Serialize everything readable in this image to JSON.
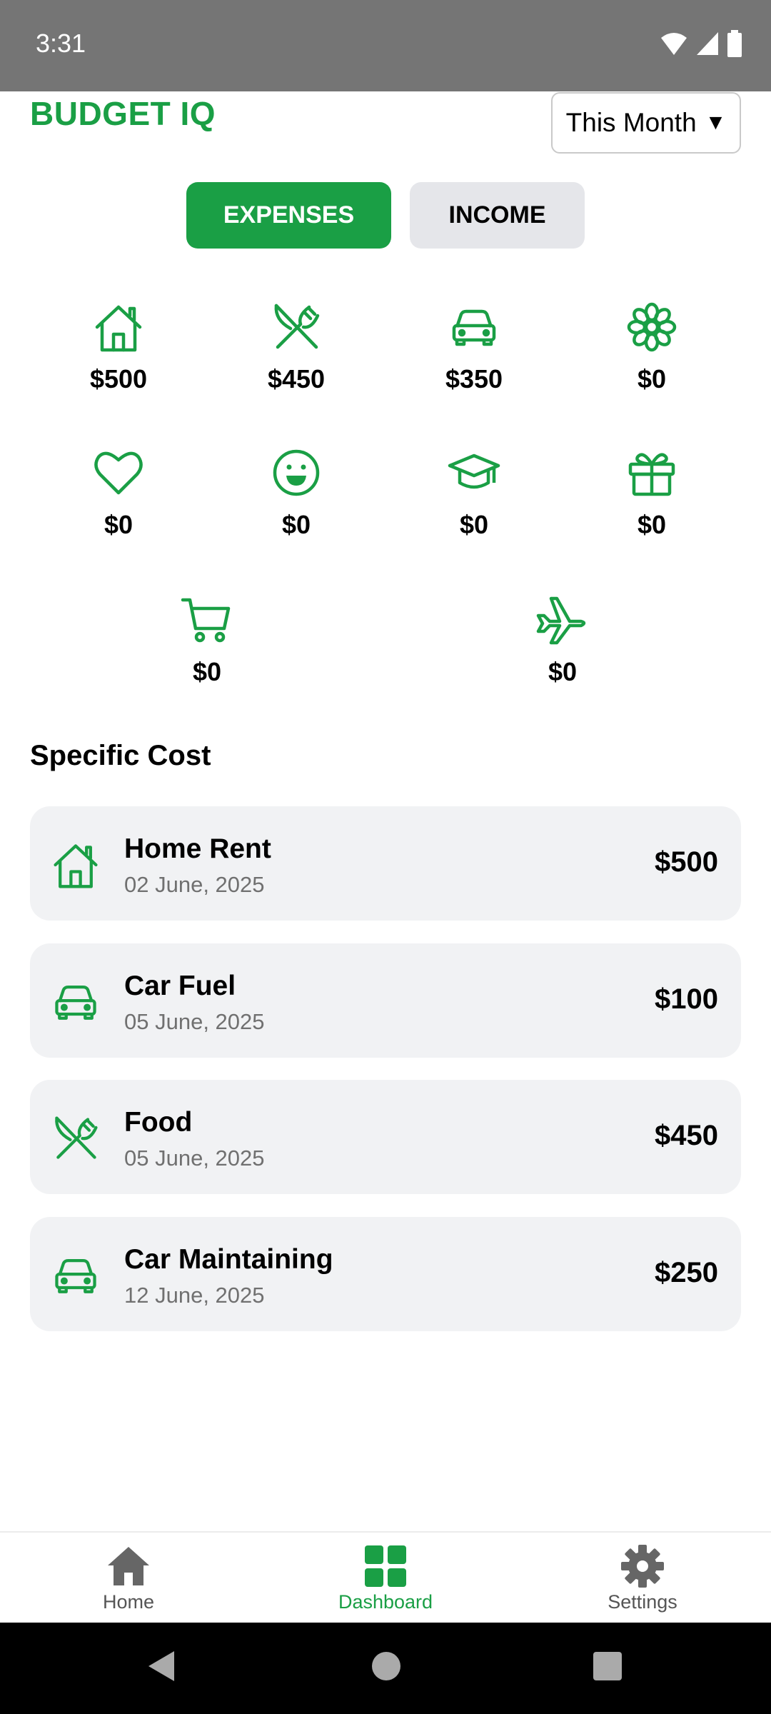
{
  "status_bar": {
    "time": "3:31"
  },
  "header": {
    "title": "BUDGET IQ",
    "period": "This Month",
    "period_caret": "▼"
  },
  "tabs": {
    "expenses": "EXPENSES",
    "income": "INCOME"
  },
  "categories": [
    {
      "icon": "home-icon",
      "amount": "$500"
    },
    {
      "icon": "fork-knife-icon",
      "amount": "$450"
    },
    {
      "icon": "car-icon",
      "amount": "$350"
    },
    {
      "icon": "flower-icon",
      "amount": "$0"
    },
    {
      "icon": "heart-icon",
      "amount": "$0"
    },
    {
      "icon": "smile-icon",
      "amount": "$0"
    },
    {
      "icon": "graduation-cap-icon",
      "amount": "$0"
    },
    {
      "icon": "gift-icon",
      "amount": "$0"
    },
    {
      "icon": "cart-icon",
      "amount": "$0"
    },
    {
      "icon": "airplane-icon",
      "amount": "$0"
    }
  ],
  "specific_cost": {
    "title": "Specific Cost",
    "items": [
      {
        "icon": "home-icon",
        "name": "Home Rent",
        "date": "02 June, 2025",
        "amount": "$500"
      },
      {
        "icon": "car-icon",
        "name": "Car Fuel",
        "date": "05 June, 2025",
        "amount": "$100"
      },
      {
        "icon": "fork-knife-icon",
        "name": "Food",
        "date": "05 June, 2025",
        "amount": "$450"
      },
      {
        "icon": "car-icon",
        "name": "Car Maintaining",
        "date": "12 June, 2025",
        "amount": "$250"
      }
    ]
  },
  "bottom_nav": {
    "home": "Home",
    "dashboard": "Dashboard",
    "settings": "Settings",
    "active": "Dashboard"
  },
  "colors": {
    "accent": "#1a9f45",
    "card_bg": "#f1f2f4",
    "status_bar": "#757575"
  }
}
